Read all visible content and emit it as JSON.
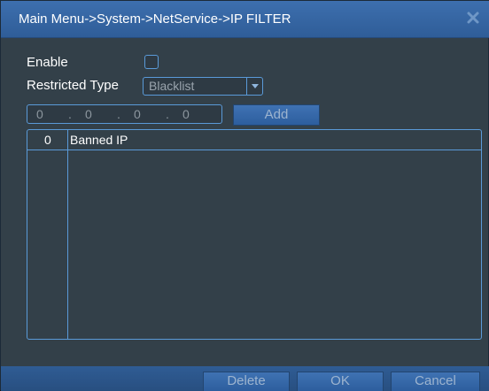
{
  "window": {
    "title": "Main Menu->System->NetService->IP FILTER"
  },
  "form": {
    "enable_label": "Enable",
    "enable_checked": false,
    "restricted_type_label": "Restricted Type",
    "restricted_type_value": "Blacklist",
    "ip_octets": [
      "0",
      "0",
      "0",
      "0"
    ],
    "ip_separator": ".",
    "add_label": "Add"
  },
  "list": {
    "columns": [
      "0",
      "Banned IP"
    ],
    "rows": []
  },
  "footer": {
    "delete_label": "Delete",
    "ok_label": "OK",
    "cancel_label": "Cancel"
  },
  "colors": {
    "title_bar": "#2f5d98",
    "panel_background": "#334049",
    "border_accent": "#5a9ad8",
    "button_fill": "#3f72b3"
  }
}
